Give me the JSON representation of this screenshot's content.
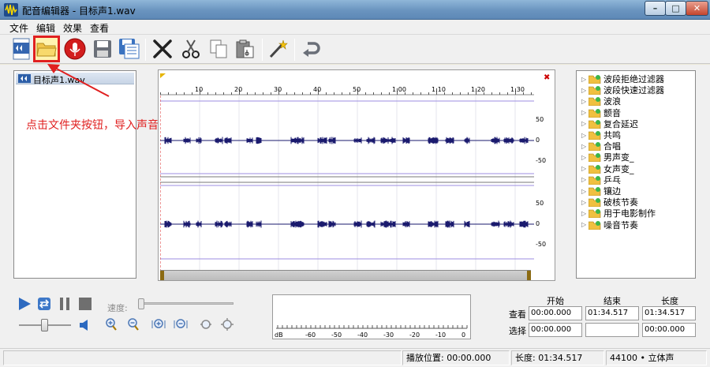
{
  "window": {
    "title": "配音编辑器 - 目标声1.wav",
    "min": "–",
    "max": "□",
    "close": "✕"
  },
  "menu": [
    "文件",
    "编辑",
    "效果",
    "查看"
  ],
  "toolbar": {
    "icons": [
      "audio-file-icon",
      "open-folder-icon",
      "record-microphone-icon",
      "save-icon",
      "save-as-icon",
      "cut-icon",
      "scissors-icon",
      "copy-icon",
      "paste-icon",
      "magic-wand-icon",
      "undo-icon"
    ],
    "highlighted": "open-folder-icon"
  },
  "file_list": {
    "items": [
      "目标声1.wav"
    ]
  },
  "annotation": "点击文件夹按钮，导入声音文件。",
  "timeline": {
    "ticks": [
      "10",
      "20",
      "30",
      "40",
      "50",
      "1:00",
      "1:10",
      "1:20",
      "1:30"
    ],
    "close_mark": "✖"
  },
  "channels": [
    {
      "y_labels": [
        "50",
        "0",
        "-50"
      ]
    },
    {
      "y_labels": [
        "50",
        "0",
        "-50"
      ]
    }
  ],
  "effects": {
    "items": [
      "波段拒绝过滤器",
      "波段快速过滤器",
      "波浪",
      "颤音",
      "复合延迟",
      "共鸣",
      "合唱",
      "男声变_",
      "女声变_",
      "乒乓",
      "镶边",
      "破核节奏",
      "用于电影制作",
      "噪音节奏"
    ]
  },
  "transport": {
    "speed_label": "速度:"
  },
  "meter": {
    "labels": [
      "dB",
      "-60",
      "-50",
      "-40",
      "-30",
      "-20",
      "-10",
      "0"
    ]
  },
  "selection": {
    "headers": [
      "开始",
      "结束",
      "长度"
    ],
    "rows": [
      {
        "label": "查看",
        "start": "00:00.000",
        "end": "01:34.517",
        "length": "01:34.517"
      },
      {
        "label": "选择",
        "start": "00:00.000",
        "end": "",
        "length": "00:00.000"
      }
    ]
  },
  "status": {
    "play_position": "播放位置: 00:00.000",
    "length": "长度: 01:34.517",
    "format": "44100 • 立体声"
  },
  "colors": {
    "highlight": "#e02020",
    "waveform": "#1a1a6e"
  }
}
